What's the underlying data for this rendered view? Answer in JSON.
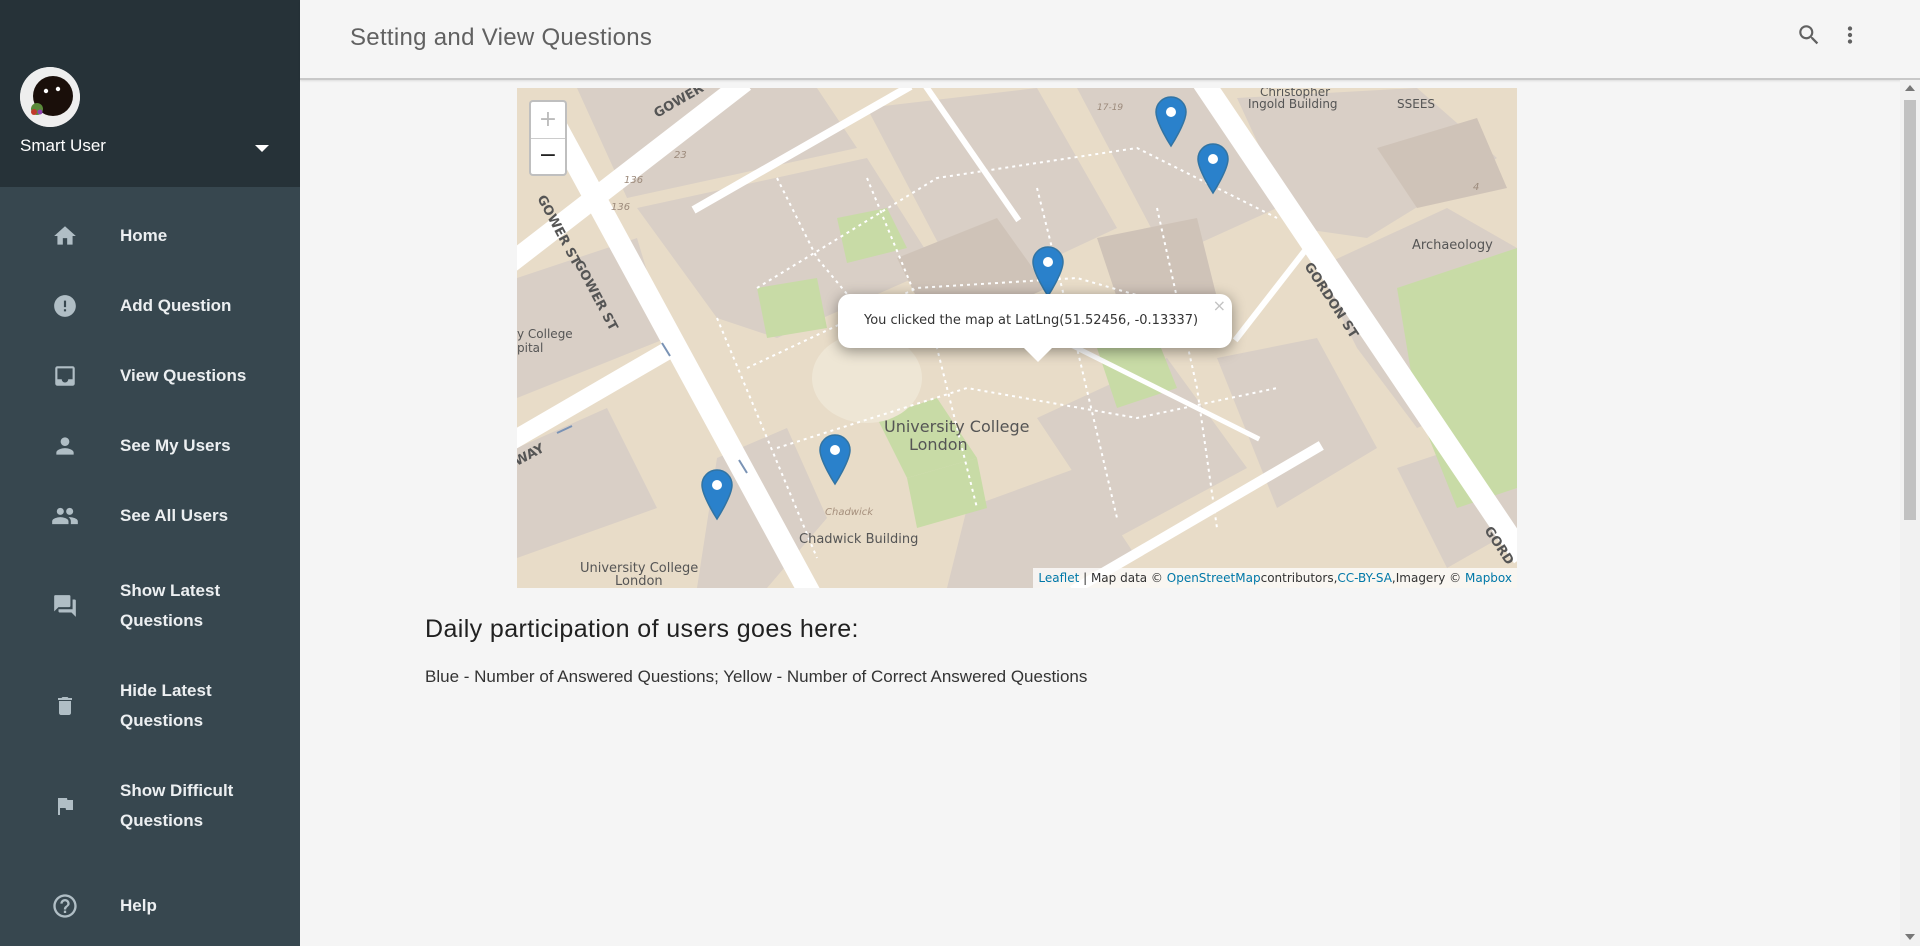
{
  "app": {
    "title": "Setting and View Questions"
  },
  "user": {
    "name": "Smart User"
  },
  "sidebar": {
    "items": [
      {
        "label": "Home",
        "icon": "home-icon"
      },
      {
        "label": "Add Question",
        "icon": "alert-circle-icon"
      },
      {
        "label": "View Questions",
        "icon": "inbox-icon"
      },
      {
        "label": "See My Users",
        "icon": "person-icon"
      },
      {
        "label": "See All Users",
        "icon": "people-icon"
      },
      {
        "label": "Show Latest Questions",
        "icon": "forum-icon"
      },
      {
        "label": "Hide Latest Questions",
        "icon": "trash-icon"
      },
      {
        "label": "Show Difficult Questions",
        "icon": "flag-icon"
      },
      {
        "label": "Help",
        "icon": "help-icon"
      }
    ]
  },
  "header": {
    "icons": [
      "search-icon",
      "more-vert-icon"
    ]
  },
  "map": {
    "zoom_in": "+",
    "zoom_out": "−",
    "popup": {
      "text": "You clicked the map at LatLng(51.52456, -0.13337)",
      "close": "×"
    },
    "attribution": {
      "leaflet": "Leaflet",
      "sep": " | Map data © ",
      "osm": "OpenStreetMap",
      "contrib": "contributors,",
      "ccbysa": "CC-BY-SA",
      "imagery": ",Imagery © ",
      "mapbox": "Mapbox"
    },
    "labels": {
      "ucl": "University College",
      "london": "London",
      "ucl2": "University College",
      "london2": "London",
      "chadwick_building": "Chadwick Building",
      "chadwick": "Chadwick",
      "archaeology": "Archaeology",
      "ssees": "SSEES",
      "christopher": "Christopher",
      "ingold": "Ingold Building",
      "gower_st": "GOWER ST",
      "gower_st2": "GOWER ST",
      "gower_top": "GOWER",
      "gordon_st": "GORDON ST",
      "gord": "GORD",
      "way": "WAY",
      "college_frag": "y College",
      "pital_frag": "pital",
      "n1719": "17-19",
      "n23": "23",
      "n136a": "136",
      "n136b": "136",
      "n4": "4"
    }
  },
  "content": {
    "heading": "Daily participation of users goes here:",
    "legend": "Blue - Number of Answered Questions; Yellow - Number of Correct Answered Questions"
  },
  "colors": {
    "sidebar_bg": "#37474f",
    "sidebar_header_bg": "#263238",
    "marker": "#2a81cb",
    "link": "#0078a8"
  }
}
